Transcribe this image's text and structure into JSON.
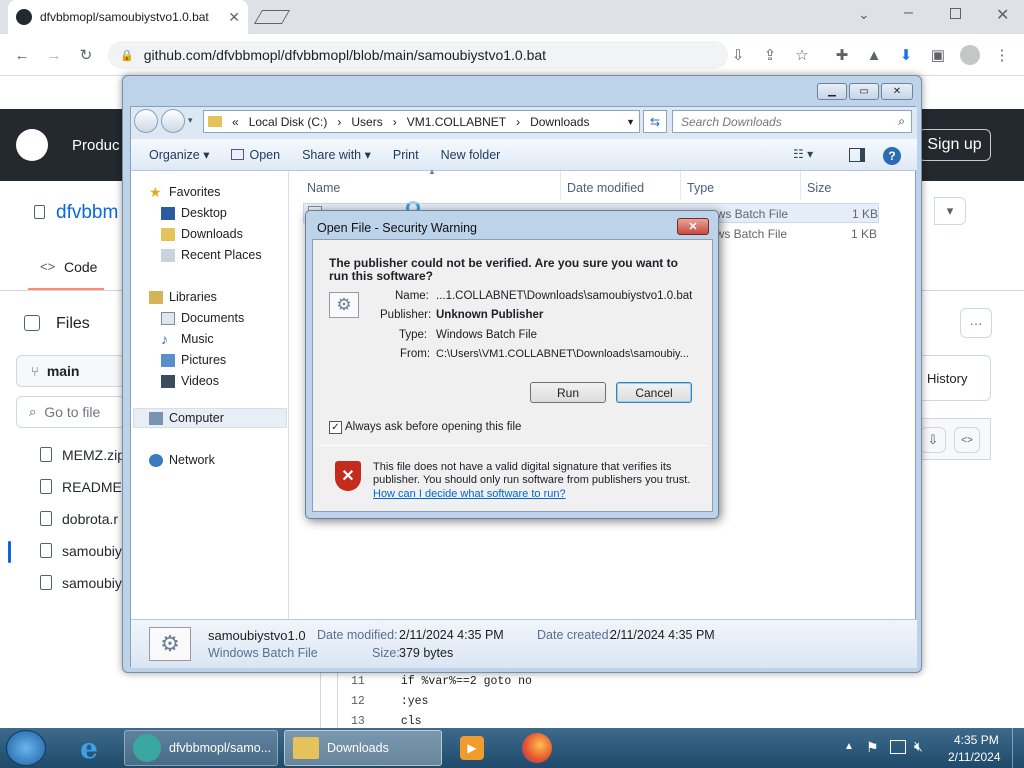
{
  "browser": {
    "tab_title": "dfvbbmopl/samoubiystvo1.0.bat",
    "url": "github.com/dfvbbmopl/dfvbbmopl/blob/main/samoubiystvo1.0.bat"
  },
  "github": {
    "nav_item": "Produc",
    "sign_up": "Sign up",
    "repo": "dfvbbm",
    "tab_code": "Code",
    "files_title": "Files",
    "branch": "main",
    "goto_file": "Go to file",
    "history": "History",
    "files": [
      "MEMZ.zip",
      "README.",
      "dobrota.r",
      "samoubiy",
      "samoubiy"
    ],
    "code_lines": [
      {
        "num": "11",
        "code": "if %var%==2 goto no"
      },
      {
        "num": "12",
        "code": ":yes"
      },
      {
        "num": "13",
        "code": "cls"
      }
    ]
  },
  "explorer": {
    "breadcrumb": [
      "«",
      "Local Disk (C:)",
      "Users",
      "VM1.COLLABNET",
      "Downloads"
    ],
    "search_placeholder": "Search Downloads",
    "commands": [
      "Organize",
      "Open",
      "Share with",
      "Print",
      "New folder"
    ],
    "nav": {
      "favorites": "Favorites",
      "desktop": "Desktop",
      "downloads": "Downloads",
      "recent": "Recent Places",
      "libraries": "Libraries",
      "documents": "Documents",
      "music": "Music",
      "pictures": "Pictures",
      "videos": "Videos",
      "computer": "Computer",
      "network": "Network"
    },
    "columns": {
      "name": "Name",
      "date": "Date modified",
      "type": "Type",
      "size": "Size"
    },
    "rows": [
      {
        "type": "ows Batch File",
        "size": "1 KB"
      },
      {
        "type": "ows Batch File",
        "size": "1 KB"
      }
    ],
    "details": {
      "name": "samoubiystvo1.0",
      "kind": "Windows Batch File",
      "modified_label": "Date modified:",
      "modified": "2/11/2024 4:35 PM",
      "created_label": "Date created:",
      "created": "2/11/2024 4:35 PM",
      "size_label": "Size:",
      "size": "379 bytes"
    }
  },
  "dialog": {
    "title": "Open File - Security Warning",
    "question": "The publisher could not be verified.  Are you sure you want to run this software?",
    "fields": [
      {
        "label": "Name:",
        "value": "...1.COLLABNET\\Downloads\\samoubiystvo1.0.bat"
      },
      {
        "label": "Publisher:",
        "value": "Unknown Publisher"
      },
      {
        "label": "Type:",
        "value": "Windows Batch File"
      },
      {
        "label": "From:",
        "value": "C:\\Users\\VM1.COLLABNET\\Downloads\\samoubiy..."
      }
    ],
    "run": "Run",
    "cancel": "Cancel",
    "always_ask": "Always ask before opening this file",
    "warning": "This file does not have a valid digital signature that verifies its publisher.  You should only run software from publishers you trust.",
    "help_link": "How can I decide what software to run?"
  },
  "taskbar": {
    "items": [
      "dfvbbmopl/samo...",
      "Downloads"
    ],
    "time": "4:35 PM",
    "date": "2/11/2024"
  }
}
